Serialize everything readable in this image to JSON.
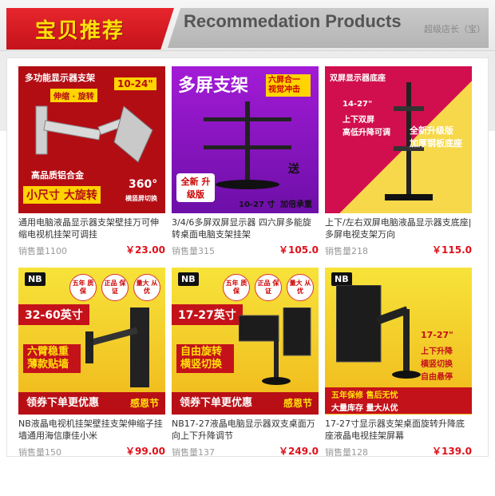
{
  "header": {
    "title_cn": "宝贝推荐",
    "title_en": "Recommedation Products",
    "shop_label": "超级店长（宝）"
  },
  "products": [
    {
      "title": "通用电脑液晶显示器支架壁挂万可伸缩电视机挂架可调挂",
      "sales": "销售量1100",
      "price": "￥23.00",
      "image_text": {
        "top": "多功能显示器支架",
        "size_badge": "10-24\"",
        "sub": "伸缩 · 旋转",
        "label1": "高品质铝合金",
        "label2": "小尺寸 大旋转",
        "badge": "360°",
        "badge_sub": "横竖屏切换"
      }
    },
    {
      "title": "3/4/6多屏双屏显示器 四六屏多能旋转桌面电脑支架挂架",
      "sales": "销售量315",
      "price": "￥105.0",
      "image_text": {
        "top": "多屏支架",
        "tag": "六屏合一 视觉冲击",
        "badge": "全新 升级版",
        "note": "送",
        "size": "10-27 寸",
        "sub": "加倍承重"
      }
    },
    {
      "title": "上下/左右双屏电脑液晶显示器支底座|多屏电视支架万向",
      "sales": "销售量218",
      "price": "￥115.0",
      "image_text": {
        "top": "双屏显示器底座",
        "feat1": "14-27\"",
        "feat2": "上下双屏",
        "feat3": "高低升降可调",
        "tag1": "全新升级版",
        "tag2": "加厚钢板底座"
      }
    },
    {
      "title": "NB液晶电视机挂架壁挂支架伸缩子挂墙通用海信康佳小米",
      "sales": "销售量150",
      "price": "￥99.00",
      "image_text": {
        "logo": "NB",
        "size": "32-60英寸",
        "feat": "六臂稳重 薄款贴墙",
        "badge1": "五年 质保",
        "badge2": "正品 保证",
        "badge3": "量大 从优",
        "banner": "领券下单更优惠",
        "banner2": "感恩节"
      }
    },
    {
      "title": "NB17-27液晶电脑显示器双支桌面万向上下升降调节",
      "sales": "销售量137",
      "price": "￥249.0",
      "image_text": {
        "logo": "NB",
        "size": "17-27英寸",
        "feat": "自由旋转 横竖切换",
        "badge1": "五年 质保",
        "badge2": "正品 保证",
        "badge3": "量大 从优",
        "banner": "领券下单更优惠",
        "banner2": "感恩节"
      }
    },
    {
      "title": "17-27寸显示器支架桌面旋转升降底座液晶电视挂架屏幕",
      "sales": "销售量128",
      "price": "￥139.0",
      "image_text": {
        "logo": "NB",
        "size": "17-27\"",
        "feat1": "上下升降",
        "feat2": "横竖切换",
        "feat3": "自由悬停",
        "tag1": "五年保修 售后无忧",
        "tag2": "大量库存 量大从优"
      }
    }
  ],
  "colors": {
    "accent_red": "#e0101a",
    "banner_red": "#c4121a",
    "banner_yellow": "#ffe10a"
  }
}
